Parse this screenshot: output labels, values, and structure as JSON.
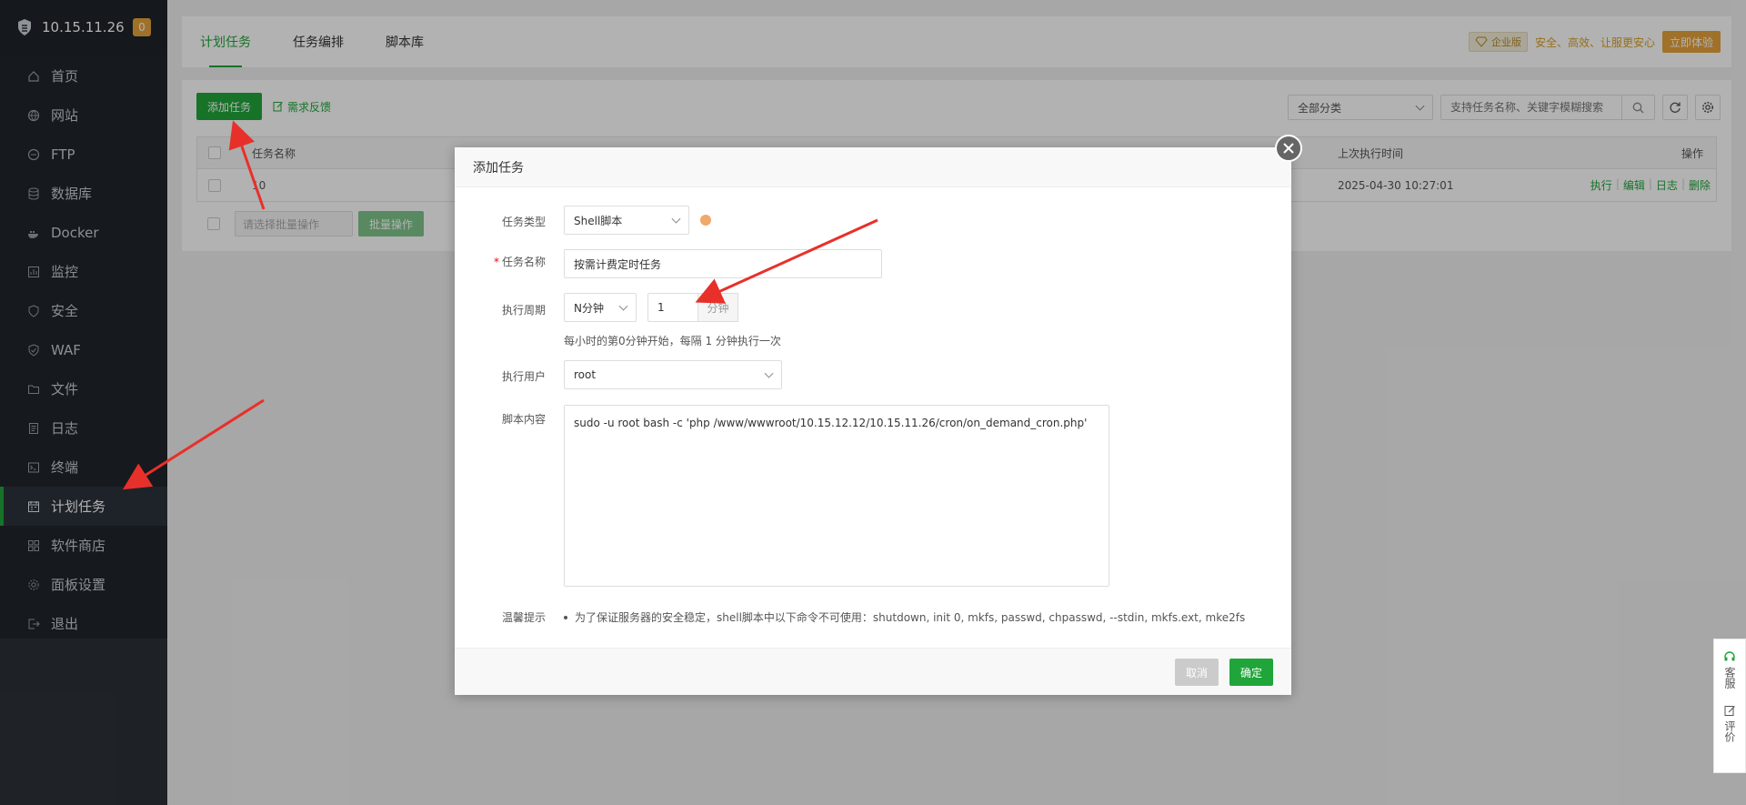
{
  "sidebar": {
    "host": "10.15.11.26",
    "badge": "0",
    "items": [
      {
        "label": "首页"
      },
      {
        "label": "网站"
      },
      {
        "label": "FTP"
      },
      {
        "label": "数据库"
      },
      {
        "label": "Docker"
      },
      {
        "label": "监控"
      },
      {
        "label": "安全"
      },
      {
        "label": "WAF"
      },
      {
        "label": "文件"
      },
      {
        "label": "日志"
      },
      {
        "label": "终端"
      },
      {
        "label": "计划任务"
      },
      {
        "label": "软件商店"
      },
      {
        "label": "面板设置"
      },
      {
        "label": "退出"
      }
    ]
  },
  "topbar": {
    "tabs": [
      "计划任务",
      "任务编排",
      "脚本库"
    ],
    "promo_badge": "企业版",
    "promo_slogan": "安全、高效、让服更安心",
    "promo_button": "立即体验"
  },
  "toolbar": {
    "add_task": "添加任务",
    "feedback": "需求反馈",
    "category": "全部分类",
    "search_placeholder": "支持任务名称、关键字模糊搜索"
  },
  "table": {
    "headers": {
      "name": "任务名称",
      "last_run": "上次执行时间",
      "actions": "操作"
    },
    "rows": [
      {
        "name": "10",
        "last_run": "2025-04-30 10:27:01"
      }
    ],
    "row_actions": [
      "执行",
      "编辑",
      "日志",
      "删除"
    ],
    "batch_select": "请选择批量操作",
    "batch_button": "批量操作"
  },
  "modal": {
    "title": "添加任务",
    "task_type_label": "任务类型",
    "task_type": "Shell脚本",
    "task_name_label": "任务名称",
    "task_name": "按需计费定时任务",
    "period_label": "执行周期",
    "period_type": "N分钟",
    "period_value": "1",
    "period_unit": "分钟",
    "period_hint": "每小时的第0分钟开始，每隔 1 分钟执行一次",
    "user_label": "执行用户",
    "user": "root",
    "script_label": "脚本内容",
    "script": "sudo -u root bash -c 'php /www/wwwroot/10.15.12.12/10.15.11.26/cron/on_demand_cron.php'",
    "tip_label": "温馨提示",
    "tip": "为了保证服务器的安全稳定，shell脚本中以下命令不可使用：shutdown, init 0, mkfs, passwd, chpasswd, --stdin, mkfs.ext, mke2fs",
    "cancel": "取消",
    "confirm": "确定"
  },
  "side_float": {
    "service": "客服",
    "review": "评价"
  },
  "colors": {
    "brand": "#20a53a",
    "sidebar_bg": "#20252b",
    "annotation": "#e8302a"
  }
}
